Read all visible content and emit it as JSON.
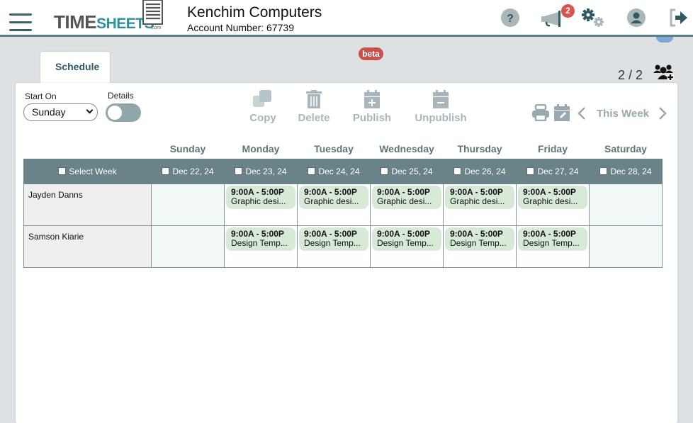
{
  "header": {
    "logo": {
      "part1": "TIME",
      "part2": "SHEETS",
      "suffix": ".com"
    },
    "company_name": "Kenchim Computers",
    "account_number": "Account Number: 67739",
    "notifications_count": "2",
    "icons": [
      "menu-icon",
      "help-icon",
      "announcements-icon",
      "settings-icon",
      "user-profile-icon",
      "logout-icon"
    ]
  },
  "tabs": [
    {
      "label": "Schedule",
      "active": true
    }
  ],
  "beta_label": "beta",
  "employee_count": "2 / 2",
  "controls": {
    "start_on_label": "Start On",
    "start_on_value": "Sunday",
    "details_label": "Details",
    "details_enabled": false
  },
  "toolbar": {
    "copy": "Copy",
    "delete": "Delete",
    "publish": "Publish",
    "unpublish": "Unpublish",
    "period_label": "This Week"
  },
  "schedule": {
    "select_week_label": "Select Week",
    "days": [
      {
        "name": "Sunday",
        "date": "Dec 22, 24"
      },
      {
        "name": "Monday",
        "date": "Dec 23, 24"
      },
      {
        "name": "Tuesday",
        "date": "Dec 24, 24"
      },
      {
        "name": "Wednesday",
        "date": "Dec 25, 24"
      },
      {
        "name": "Thursday",
        "date": "Dec 26, 24"
      },
      {
        "name": "Friday",
        "date": "Dec 27, 24"
      },
      {
        "name": "Saturday",
        "date": "Dec 28, 24"
      }
    ],
    "employees": [
      {
        "name": "Jayden Danns",
        "shifts": [
          null,
          {
            "time": "9:00A - 5:00P",
            "task": "Graphic desi..."
          },
          {
            "time": "9:00A - 5:00P",
            "task": "Graphic desi..."
          },
          {
            "time": "9:00A - 5:00P",
            "task": "Graphic desi..."
          },
          {
            "time": "9:00A - 5:00P",
            "task": "Graphic desi..."
          },
          {
            "time": "9:00A - 5:00P",
            "task": "Graphic desi..."
          },
          null
        ]
      },
      {
        "name": "Samson Kiarie",
        "shifts": [
          null,
          {
            "time": "9:00A - 5:00P",
            "task": "Design Temp..."
          },
          {
            "time": "9:00A - 5:00P",
            "task": "Design Temp..."
          },
          {
            "time": "9:00A - 5:00P",
            "task": "Design Temp..."
          },
          {
            "time": "9:00A - 5:00P",
            "task": "Design Temp..."
          },
          {
            "time": "9:00A - 5:00P",
            "task": "Design Temp..."
          },
          null
        ]
      }
    ]
  },
  "colors": {
    "brand_teal": "#2b8fa0",
    "header_rule": "#5a7f86",
    "table_header_bg": "#698389",
    "shift_bg": "#d8ead7",
    "badge_red": "#d9534f",
    "disabled_tool": "#a9b7bc"
  }
}
